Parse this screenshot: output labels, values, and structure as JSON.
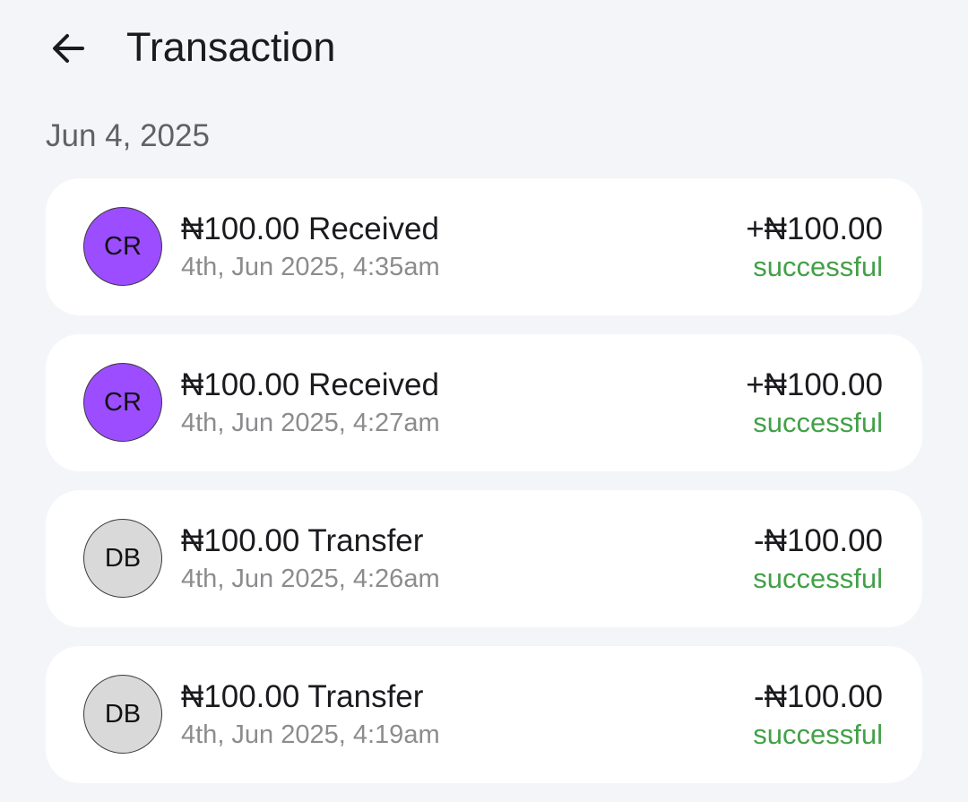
{
  "header": {
    "title": "Transaction",
    "back_icon": "arrow-left-icon"
  },
  "date_group": "Jun 4, 2025",
  "colors": {
    "background": "#f4f5f9",
    "card": "#ffffff",
    "credit_avatar": "#9b4dff",
    "debit_avatar": "#d9d9d9",
    "status_success": "#43a047"
  },
  "transactions": [
    {
      "initials": "CR",
      "kind": "credit",
      "title": "₦100.00 Received",
      "time": "4th, Jun 2025, 4:35am",
      "amount": "+₦100.00",
      "status": "successful"
    },
    {
      "initials": "CR",
      "kind": "credit",
      "title": "₦100.00 Received",
      "time": "4th, Jun 2025, 4:27am",
      "amount": "+₦100.00",
      "status": "successful"
    },
    {
      "initials": "DB",
      "kind": "debit",
      "title": "₦100.00 Transfer",
      "time": "4th, Jun 2025, 4:26am",
      "amount": "-₦100.00",
      "status": "successful"
    },
    {
      "initials": "DB",
      "kind": "debit",
      "title": "₦100.00 Transfer",
      "time": "4th, Jun 2025, 4:19am",
      "amount": "-₦100.00",
      "status": "successful"
    }
  ]
}
